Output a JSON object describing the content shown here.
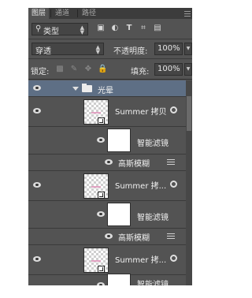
{
  "tabs": [
    {
      "label": "图层",
      "active": true
    },
    {
      "label": "通道",
      "active": false
    },
    {
      "label": "路径",
      "active": false
    }
  ],
  "filter": {
    "kind_label": "类型",
    "icons": [
      "image-filter-icon",
      "adjustment-filter-icon",
      "type-filter-icon",
      "shape-filter-icon",
      "smart-object-filter-icon"
    ]
  },
  "blend": {
    "mode": "穿透",
    "opacity_label": "不透明度:",
    "opacity_value": "100%"
  },
  "lock": {
    "label": "锁定:",
    "fill_label": "填充:",
    "fill_value": "100%"
  },
  "group": {
    "name": "光晕"
  },
  "layers": [
    {
      "name": "Summer 拷贝",
      "filter_label": "智能滤镜",
      "effect_label": "高斯模糊"
    },
    {
      "name": "Summer 拷...",
      "filter_label": "智能滤镜",
      "effect_label": "高斯模糊"
    },
    {
      "name": "Summer 拷...",
      "filter_label": "智能滤镜",
      "effect_label": ""
    }
  ],
  "colors": {
    "panel_bg": "#535353",
    "selected_group": "#5e6f85"
  }
}
